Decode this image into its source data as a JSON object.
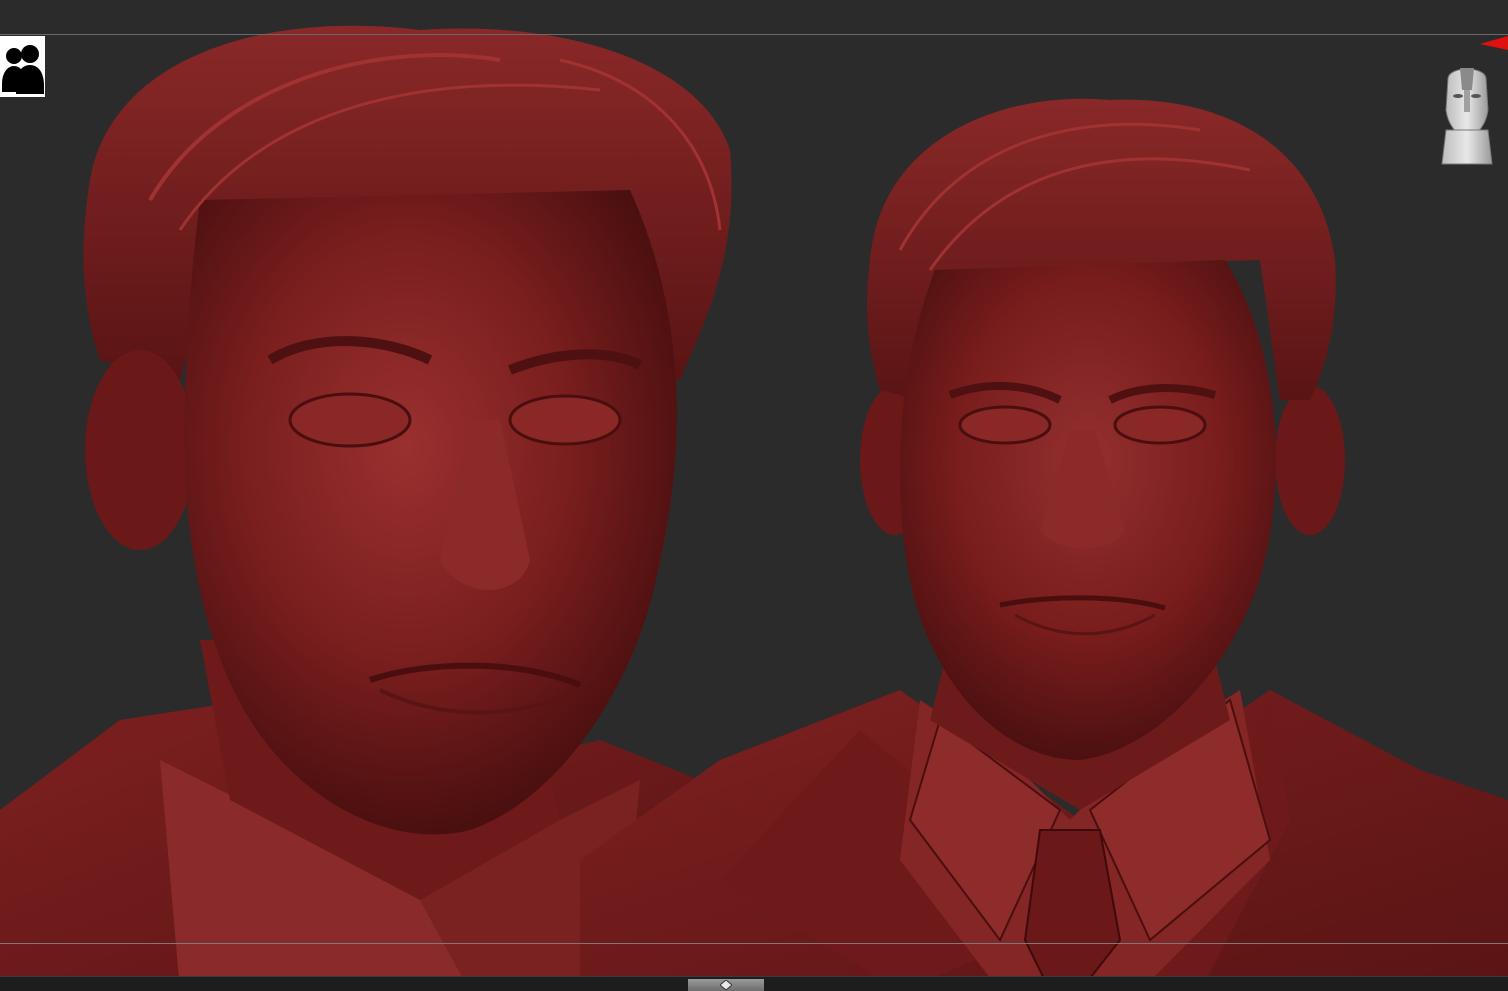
{
  "viewport": {
    "background_color": "#2b2b2b",
    "material_color": "#7a1c1c",
    "guide_line_color": "#6a6a6a"
  },
  "toolbar": {
    "perspective_icon": "two-heads-silhouette-icon"
  },
  "navigation": {
    "nav_cube_icon": "head-orientation-gizmo-icon",
    "marker_icon": "red-triangle-marker-icon",
    "marker_color": "#e01010"
  },
  "bottom_tray": {
    "handle_icon": "tray-toggle-arrow-icon"
  }
}
